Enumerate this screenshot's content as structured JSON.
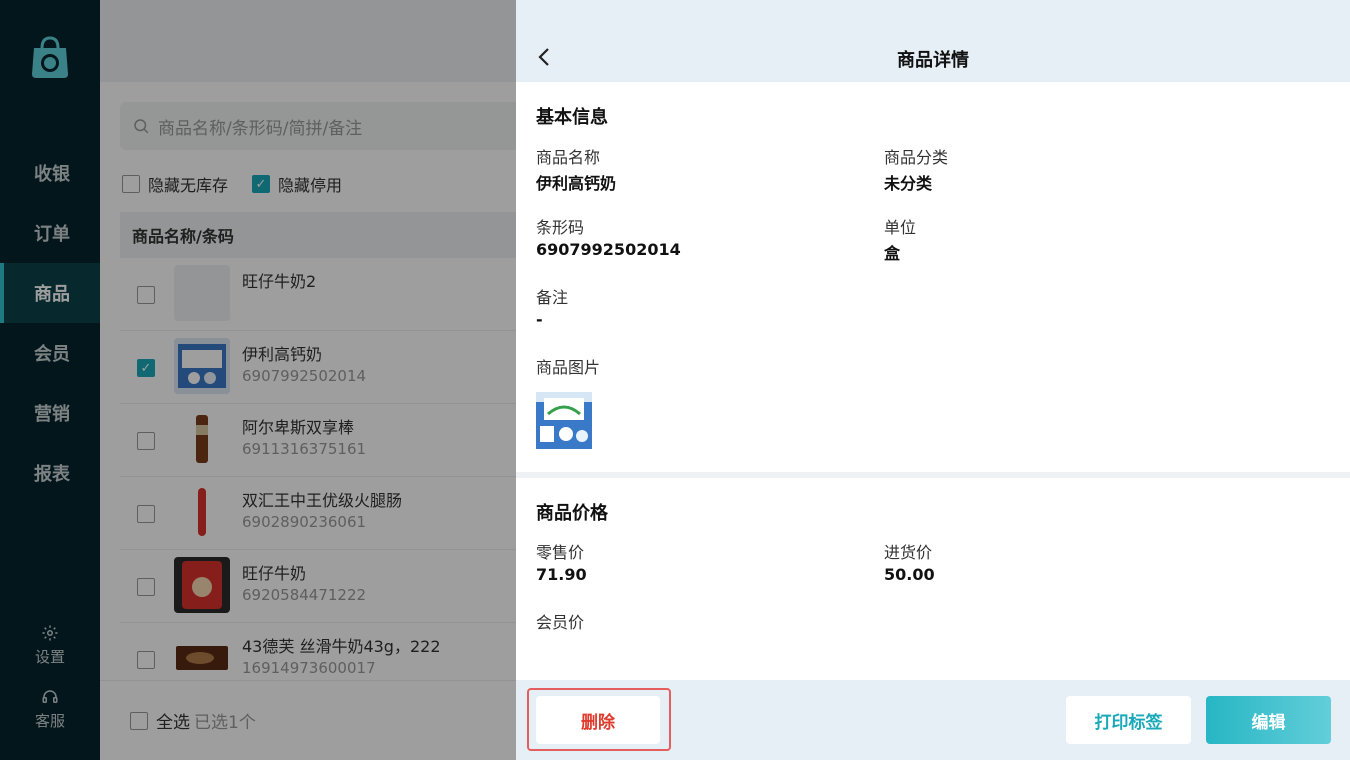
{
  "sidebar": {
    "nav": [
      {
        "label": "收银"
      },
      {
        "label": "订单"
      },
      {
        "label": "商品"
      },
      {
        "label": "会员"
      },
      {
        "label": "营销"
      },
      {
        "label": "报表"
      }
    ],
    "active": "商品",
    "settings_label": "设置",
    "service_label": "客服"
  },
  "list": {
    "search_placeholder": "商品名称/条形码/简拼/备注",
    "filter_hide_no_stock": "隐藏无库存",
    "filter_hide_disabled": "隐藏停用",
    "column_header": "商品名称/条码",
    "items": [
      {
        "name": "旺仔牛奶2",
        "code": "",
        "checked": false
      },
      {
        "name": "伊利高钙奶",
        "code": "6907992502014",
        "checked": true
      },
      {
        "name": "阿尔卑斯双享棒",
        "code": "6911316375161",
        "checked": false
      },
      {
        "name": "双汇王中王优级火腿肠",
        "code": "6902890236061",
        "checked": false
      },
      {
        "name": "旺仔牛奶",
        "code": "6920584471222",
        "checked": false
      },
      {
        "name": "43德芙 丝滑牛奶43g，222",
        "code": "16914973600017",
        "checked": false
      }
    ],
    "select_all_label": "全选",
    "selected_count_label": "已选1个"
  },
  "detail": {
    "title": "商品详情",
    "basic_section": "基本信息",
    "name_label": "商品名称",
    "name_value": "伊利高钙奶",
    "category_label": "商品分类",
    "category_value": "未分类",
    "barcode_label": "条形码",
    "barcode_value": "6907992502014",
    "unit_label": "单位",
    "unit_value": "盒",
    "remark_label": "备注",
    "remark_value": "-",
    "image_label": "商品图片",
    "price_section": "商品价格",
    "retail_label": "零售价",
    "retail_value": "71.90",
    "purchase_label": "进货价",
    "purchase_value": "50.00",
    "member_label": "会员价",
    "member_value": ""
  },
  "actions": {
    "delete_label": "删除",
    "print_label": "打印标签",
    "edit_label": "编辑"
  },
  "colors": {
    "sidebar_bg": "#06252c",
    "accent": "#1aa9b9",
    "danger": "#e03a2d"
  }
}
